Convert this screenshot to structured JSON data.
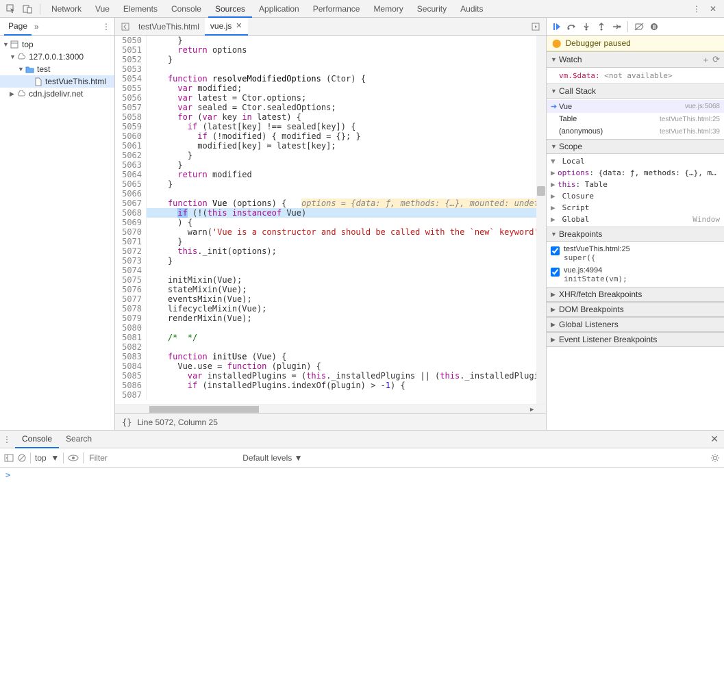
{
  "topTabs": [
    "Network",
    "Vue",
    "Elements",
    "Console",
    "Sources",
    "Application",
    "Performance",
    "Memory",
    "Security",
    "Audits"
  ],
  "topActive": "Sources",
  "navigator": {
    "pageTab": "Page",
    "tree": [
      {
        "label": "top",
        "icon": "window",
        "depth": 0,
        "arrow": "▼"
      },
      {
        "label": "127.0.0.1:3000",
        "icon": "cloud",
        "depth": 1,
        "arrow": "▼"
      },
      {
        "label": "test",
        "icon": "folder",
        "depth": 2,
        "arrow": "▼"
      },
      {
        "label": "testVueThis.html",
        "icon": "file",
        "depth": 3,
        "arrow": "",
        "selected": true
      },
      {
        "label": "cdn.jsdelivr.net",
        "icon": "cloud",
        "depth": 1,
        "arrow": "▶"
      }
    ]
  },
  "openTabs": [
    {
      "name": "testVueThis.html",
      "active": false
    },
    {
      "name": "vue.js",
      "active": true
    }
  ],
  "code": {
    "start": 5050,
    "lines": [
      {
        "t": "      }"
      },
      {
        "t": "      <kw>return</kw> options"
      },
      {
        "t": "    }"
      },
      {
        "t": ""
      },
      {
        "t": "    <kw>function</kw> <fn>resolveModifiedOptions</fn> (Ctor) {"
      },
      {
        "t": "      <kw>var</kw> modified;"
      },
      {
        "t": "      <kw>var</kw> latest = Ctor.options;"
      },
      {
        "t": "      <kw>var</kw> sealed = Ctor.sealedOptions;"
      },
      {
        "t": "      <kw>for</kw> (<kw>var</kw> key <kw>in</kw> latest) {"
      },
      {
        "t": "        <kw>if</kw> (latest[key] !== sealed[key]) {"
      },
      {
        "t": "          <kw>if</kw> (!modified) { modified = {}; }"
      },
      {
        "t": "          modified[key] = latest[key];"
      },
      {
        "t": "        }"
      },
      {
        "t": "      }"
      },
      {
        "t": "      <kw>return</kw> modified"
      },
      {
        "t": "    }"
      },
      {
        "t": ""
      },
      {
        "t": "    <kw>function</kw> <fn>Vue</fn> (options) {   <span class='var-inline' style='background:rgba(255,194,61,0.25)'>options = {data: <i>ƒ</i>, methods: {…}, mounted: undefined, com</span>",
        "exec": true
      },
      {
        "t": "      <span style='background:#9cccfc'><kw>if</kw></span> (!(<kw>this instanceof</kw> Vue)",
        "hl": true
      },
      {
        "t": "      ) {"
      },
      {
        "t": "        warn(<str>'Vue is a constructor and should be called with the `new` keyword'</str>);"
      },
      {
        "t": "      }"
      },
      {
        "t": "      <kw>this</kw>._init(options);"
      },
      {
        "t": "    }"
      },
      {
        "t": ""
      },
      {
        "t": "    initMixin(Vue);"
      },
      {
        "t": "    stateMixin(Vue);"
      },
      {
        "t": "    eventsMixin(Vue);"
      },
      {
        "t": "    lifecycleMixin(Vue);"
      },
      {
        "t": "    renderMixin(Vue);"
      },
      {
        "t": ""
      },
      {
        "t": "    <cm>/*  */</cm>"
      },
      {
        "t": ""
      },
      {
        "t": "    <kw>function</kw> <fn>initUse</fn> (Vue) {"
      },
      {
        "t": "      Vue.use = <kw>function</kw> (plugin) {"
      },
      {
        "t": "        <kw>var</kw> installedPlugins = (<kw>this</kw>._installedPlugins || (<kw>this</kw>._installedPlugins = []))"
      },
      {
        "t": "        <kw>if</kw> (installedPlugins.indexOf(plugin) > -<nm>1</nm>) {"
      },
      {
        "t": ""
      }
    ]
  },
  "statusBar": {
    "pos": "Line 5072, Column 25"
  },
  "debugger": {
    "pausedMsg": "Debugger paused",
    "watch": {
      "title": "Watch",
      "expr": "vm.$data:",
      "val": " <not available>"
    },
    "callStack": {
      "title": "Call Stack",
      "frames": [
        {
          "name": "Vue",
          "loc": "vue.js:5068",
          "active": true
        },
        {
          "name": "Table",
          "loc": "testVueThis.html:25"
        },
        {
          "name": "(anonymous)",
          "loc": "testVueThis.html:39"
        }
      ]
    },
    "scope": {
      "title": "Scope",
      "groups": [
        {
          "name": "Local",
          "open": true,
          "items": [
            {
              "k": "options",
              "v": ": {data: ƒ, methods: {…}, m…",
              "expandable": true
            },
            {
              "k": "this",
              "v": ": Table",
              "expandable": true
            }
          ]
        },
        {
          "name": "Closure",
          "open": false
        },
        {
          "name": "Script",
          "open": false
        },
        {
          "name": "Global",
          "open": false,
          "right": "Window"
        }
      ]
    },
    "breakpoints": {
      "title": "Breakpoints",
      "items": [
        {
          "loc": "testVueThis.html:25",
          "code": "super({",
          "checked": true
        },
        {
          "loc": "vue.js:4994",
          "code": "initState(vm);",
          "checked": true
        }
      ]
    },
    "xhr": "XHR/fetch Breakpoints",
    "dom": "DOM Breakpoints",
    "listeners": "Global Listeners",
    "evtListeners": "Event Listener Breakpoints"
  },
  "drawer": {
    "tabs": [
      "Console",
      "Search"
    ],
    "active": "Console",
    "context": "top",
    "filterPlaceholder": "Filter",
    "levels": "Default levels",
    "prompt": ">"
  }
}
